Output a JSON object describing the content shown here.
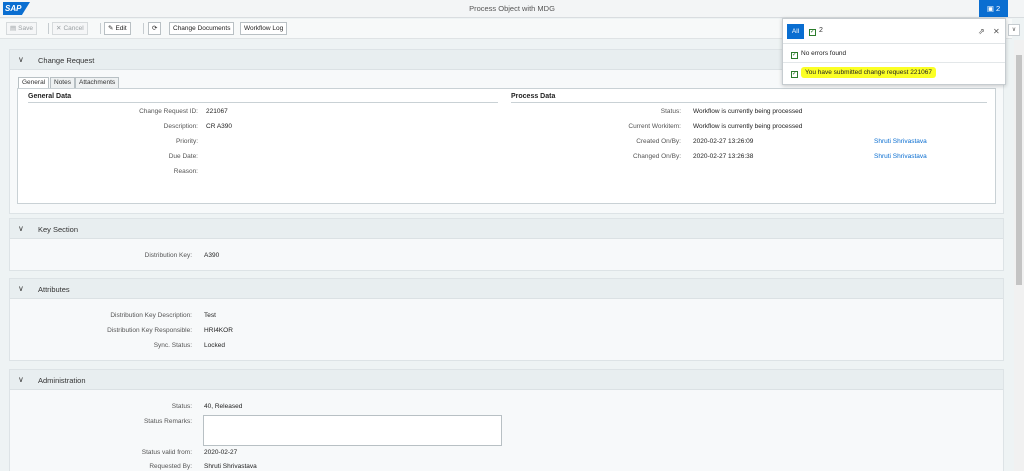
{
  "shell": {
    "logo": "SAP",
    "title": "Process Object with MDG",
    "notif_count": "2"
  },
  "toolbar": {
    "save": "Save",
    "cancel": "Cancel",
    "edit": "Edit",
    "change_docs": "Change Documents",
    "workflow_log": "Workflow Log"
  },
  "change_request": {
    "title": "Change Request",
    "tabs": [
      "General",
      "Notes",
      "Attachments"
    ],
    "general_title": "General Data",
    "process_title": "Process Data",
    "general": [
      {
        "label": "Change Request ID:",
        "value": "221067"
      },
      {
        "label": "Description:",
        "value": "CR A390"
      },
      {
        "label": "Priority:",
        "value": ""
      },
      {
        "label": "Due Date:",
        "value": ""
      },
      {
        "label": "Reason:",
        "value": ""
      }
    ],
    "process": [
      {
        "label": "Status:",
        "value": "Workflow is currently being processed",
        "link": ""
      },
      {
        "label": "Current Workitem:",
        "value": "Workflow is currently being processed",
        "link": ""
      },
      {
        "label": "Created On/By:",
        "value": "2020-02-27 13:26:09",
        "link": "Shruti Shrivastava"
      },
      {
        "label": "Changed On/By:",
        "value": "2020-02-27 13:26:38",
        "link": "Shruti Shrivastava"
      }
    ]
  },
  "key_section": {
    "title": "Key Section",
    "fields": [
      {
        "label": "Distribution Key:",
        "value": "A390"
      }
    ]
  },
  "attributes": {
    "title": "Attributes",
    "fields": [
      {
        "label": "Distribution Key Description:",
        "value": "Test"
      },
      {
        "label": "Distribution Key Responsible:",
        "value": "HRI4KOR"
      },
      {
        "label": "Sync. Status:",
        "value": "Locked"
      }
    ]
  },
  "administration": {
    "title": "Administration",
    "status_label": "Status:",
    "status_value": "40, Released",
    "remarks_label": "Status Remarks:",
    "valid_label": "Status valid from:",
    "valid_value": "2020-02-27",
    "requested_label": "Requested By:",
    "requested_value": "Shruti Shrivastava"
  },
  "messages": {
    "all_label": "All",
    "count": "2",
    "items": [
      "No errors found",
      "You have submitted change request 221067"
    ]
  },
  "colors": {
    "accent": "#0a6ed1",
    "highlight": "#fbff24",
    "success": "#2b7c2b"
  }
}
